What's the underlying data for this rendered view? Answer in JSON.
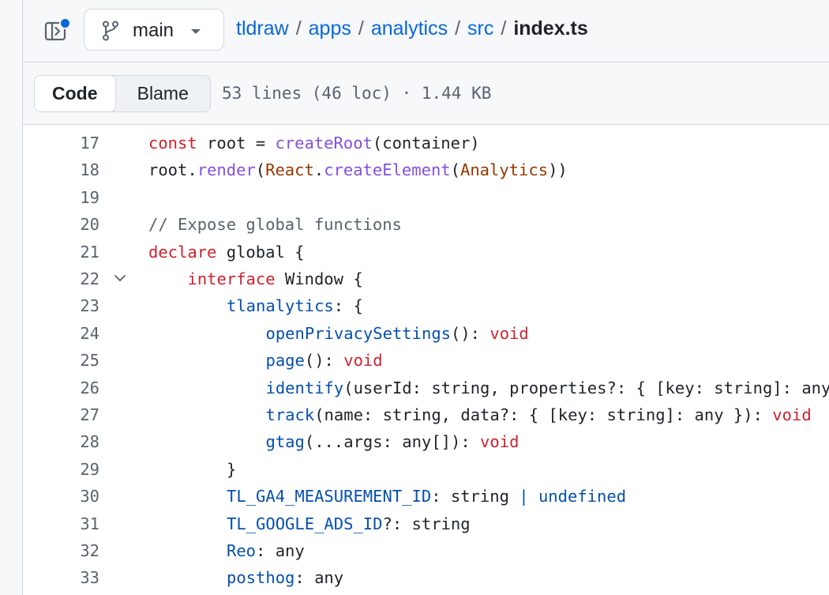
{
  "header": {
    "branch": "main",
    "breadcrumb": [
      {
        "label": "tldraw",
        "sep": "/"
      },
      {
        "label": "apps",
        "sep": "/"
      },
      {
        "label": "analytics",
        "sep": "/"
      },
      {
        "label": "src",
        "sep": "/"
      }
    ],
    "current_file": "index.ts"
  },
  "toolbar": {
    "code_tab": "Code",
    "blame_tab": "Blame",
    "file_meta": "53 lines (46 loc) · 1.44 KB"
  },
  "code": {
    "lines": [
      {
        "n": "17",
        "indent": 0,
        "tokens": [
          [
            "kw",
            "const"
          ],
          [
            "t",
            " root = "
          ],
          [
            "fn",
            "createRoot"
          ],
          [
            "t",
            "(container)"
          ]
        ]
      },
      {
        "n": "18",
        "indent": 0,
        "tokens": [
          [
            "t",
            "root."
          ],
          [
            "fn",
            "render"
          ],
          [
            "t",
            "("
          ],
          [
            "ty",
            "React"
          ],
          [
            "t",
            "."
          ],
          [
            "fn",
            "createElement"
          ],
          [
            "t",
            "("
          ],
          [
            "ty",
            "Analytics"
          ],
          [
            "t",
            "))"
          ]
        ]
      },
      {
        "n": "19",
        "indent": 0,
        "tokens": []
      },
      {
        "n": "20",
        "indent": 0,
        "tokens": [
          [
            "cm",
            "// Expose global functions"
          ]
        ]
      },
      {
        "n": "21",
        "indent": 0,
        "tokens": [
          [
            "kw",
            "declare"
          ],
          [
            "t",
            " global {"
          ]
        ]
      },
      {
        "n": "22",
        "indent": 1,
        "fold": true,
        "tokens": [
          [
            "kw",
            "interface"
          ],
          [
            "t",
            " Window {"
          ]
        ]
      },
      {
        "n": "23",
        "indent": 2,
        "tokens": [
          [
            "pr",
            "tlanalytics"
          ],
          [
            "t",
            ": {"
          ]
        ]
      },
      {
        "n": "24",
        "indent": 3,
        "tokens": [
          [
            "pr",
            "openPrivacySettings"
          ],
          [
            "t",
            "(): "
          ],
          [
            "kw",
            "void"
          ]
        ]
      },
      {
        "n": "25",
        "indent": 3,
        "tokens": [
          [
            "pr",
            "page"
          ],
          [
            "t",
            "(): "
          ],
          [
            "kw",
            "void"
          ]
        ]
      },
      {
        "n": "26",
        "indent": 3,
        "tokens": [
          [
            "pr",
            "identify"
          ],
          [
            "t",
            "(userId: string, properties?: { [key: string]: any"
          ]
        ]
      },
      {
        "n": "27",
        "indent": 3,
        "tokens": [
          [
            "pr",
            "track"
          ],
          [
            "t",
            "(name: string, data?: { [key: string]: any }): "
          ],
          [
            "kw",
            "void"
          ]
        ]
      },
      {
        "n": "28",
        "indent": 3,
        "tokens": [
          [
            "pr",
            "gtag"
          ],
          [
            "t",
            "(...args: any[]): "
          ],
          [
            "kw",
            "void"
          ]
        ]
      },
      {
        "n": "29",
        "indent": 2,
        "tokens": [
          [
            "t",
            "}"
          ]
        ]
      },
      {
        "n": "30",
        "indent": 2,
        "tokens": [
          [
            "pr",
            "TL_GA4_MEASUREMENT_ID"
          ],
          [
            "t",
            ": string "
          ],
          [
            "pr",
            "|"
          ],
          [
            "t",
            " "
          ],
          [
            "pr",
            "undefined"
          ]
        ]
      },
      {
        "n": "31",
        "indent": 2,
        "tokens": [
          [
            "pr",
            "TL_GOOGLE_ADS_ID"
          ],
          [
            "t",
            "?: string"
          ]
        ]
      },
      {
        "n": "32",
        "indent": 2,
        "tokens": [
          [
            "pr",
            "Reo"
          ],
          [
            "t",
            ": any"
          ]
        ]
      },
      {
        "n": "33",
        "indent": 2,
        "tokens": [
          [
            "pr",
            "posthog"
          ],
          [
            "t",
            ": any"
          ]
        ]
      }
    ]
  },
  "colors": {
    "link": "#0969da",
    "keyword": "#cf222e",
    "function": "#8250df",
    "type": "#953800",
    "property": "#0550ae",
    "comment": "#59636e"
  }
}
